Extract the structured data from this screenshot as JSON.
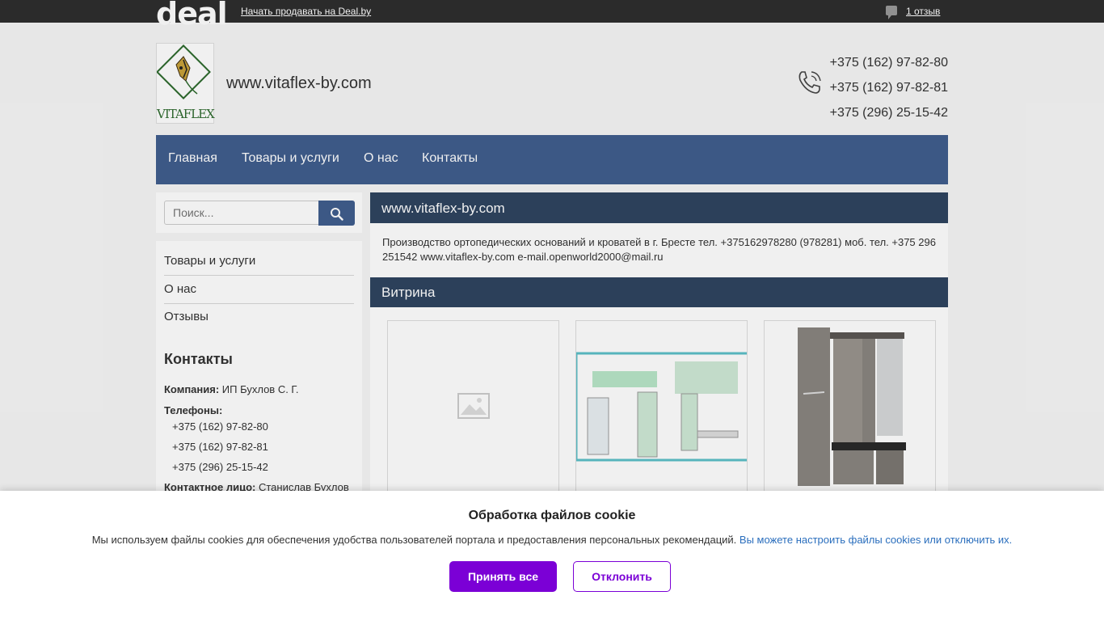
{
  "topbar": {
    "logo": "deal",
    "sell_link": "Начать продавать на Deal.by",
    "reviews_link": "1 отзыв"
  },
  "header": {
    "logo_text": "VITAFLEX",
    "site_name": "www.vitaflex-by.com",
    "phones": [
      "+375 (162) 97-82-80",
      "+375 (162) 97-82-81",
      "+375 (296) 25-15-42"
    ]
  },
  "nav": {
    "items": [
      "Главная",
      "Товары и услуги",
      "О нас",
      "Контакты"
    ]
  },
  "search": {
    "placeholder": "Поиск..."
  },
  "sidebar": {
    "links": [
      "Товары и услуги",
      "О нас",
      "Отзывы"
    ],
    "contacts_title": "Контакты",
    "company_label": "Компания:",
    "company_value": "ИП Бухлов С. Г.",
    "phones_label": "Телефоны:",
    "phones": [
      "+375 (162) 97-82-80",
      "+375 (162) 97-82-81",
      "+375 (296) 25-15-42"
    ],
    "person_label": "Контактное лицо:",
    "person_value": "Станислав Бухлов"
  },
  "main": {
    "title": "www.vitaflex-by.com",
    "description": "Производство ортопедических оснований и кроватей в г. Бресте тел. +375162978280 (978281) моб. тел. +375 296 251542 www.vitaflex-by.com e-mail.openworld2000@mail.ru",
    "vitrina_title": "Витрина"
  },
  "cookie": {
    "title": "Обработка файлов cookie",
    "text": "Мы используем файлы cookies для обеспечения удобства пользователей портала и предоставления персональных рекомендаций.",
    "link": "Вы можете настроить файлы cookies или отключить их.",
    "accept": "Принять все",
    "decline": "Отклонить"
  },
  "colors": {
    "nav": "#405e8e",
    "section_header": "#2f4460",
    "accent": "#7b00d6",
    "link": "#2a6ebd"
  },
  "icons": {
    "review": "speech-bubble-icon",
    "phone": "phone-icon",
    "search": "magnifier-icon",
    "placeholder_image": "image-placeholder-icon"
  }
}
